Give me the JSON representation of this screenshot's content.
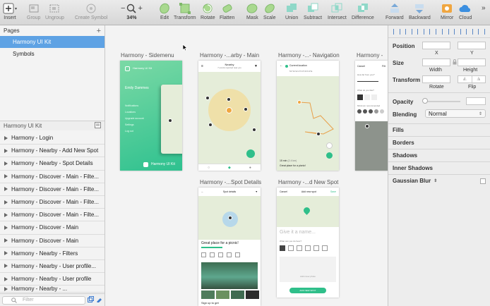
{
  "toolbar": {
    "items": [
      {
        "label": "Insert",
        "icon": "plus-icon"
      },
      {
        "label": "Group",
        "icon": "group-icon"
      },
      {
        "label": "Ungroup",
        "icon": "ungroup-icon"
      },
      {
        "label": "Create Symbol",
        "icon": "symbol-icon"
      },
      {
        "label": "34%",
        "icon": "zoom-icon"
      },
      {
        "label": "Edit",
        "icon": "edit-icon"
      },
      {
        "label": "Transform",
        "icon": "transform-icon"
      },
      {
        "label": "Rotate",
        "icon": "rotate-icon"
      },
      {
        "label": "Flatten",
        "icon": "flatten-icon"
      },
      {
        "label": "Mask",
        "icon": "mask-icon"
      },
      {
        "label": "Scale",
        "icon": "scale-icon"
      },
      {
        "label": "Union",
        "icon": "union-icon"
      },
      {
        "label": "Subtract",
        "icon": "subtract-icon"
      },
      {
        "label": "Intersect",
        "icon": "intersect-icon"
      },
      {
        "label": "Difference",
        "icon": "difference-icon"
      },
      {
        "label": "Forward",
        "icon": "forward-icon"
      },
      {
        "label": "Backward",
        "icon": "backward-icon"
      },
      {
        "label": "Mirror",
        "icon": "mirror-icon"
      },
      {
        "label": "Cloud",
        "icon": "cloud-icon"
      }
    ],
    "zoom_minus": "−",
    "zoom_plus": "+",
    "more": "»"
  },
  "pages": {
    "header": "Pages",
    "add": "+",
    "items": [
      "Harmony UI Kit",
      "Symbols"
    ]
  },
  "layers": {
    "header": "Harmony UI Kit",
    "items": [
      "Harmony - Login",
      "Harmony - Nearby - Add New Spot",
      "Harmony - Nearby - Spot Details",
      "Harmony - Discover - Main - Filte...",
      "Harmony - Discover - Main - Filte...",
      "Harmony - Discover - Main - Filte...",
      "Harmony - Discover - Main - Filte...",
      "Harmony - Discover - Main",
      "Harmony - Discover - Main",
      "Harmony - Nearby - Filters",
      "Harmony - Nearby - User profile...",
      "Harmony - Nearby - User profile",
      "Harmony - Nearby - ..."
    ],
    "filter_placeholder": "Filter"
  },
  "artboards": {
    "titles": [
      "Harmony - Sidemenu",
      "Harmony -...arby - Main",
      "Harmony -...- Navigation",
      "Harmony -",
      "Harmony -...Spot Details",
      "Harmony -...d New Spot"
    ],
    "sidemenu": {
      "brand": "Harmony UI Kit",
      "user": "Emily Dammes",
      "items": [
        "Notifications",
        "Locations",
        "Upgrade account",
        "Settings",
        "Log out"
      ],
      "footer": "Harmony UI Kit"
    },
    "main": {
      "title": "Nearby",
      "subtitle": "7 events reported near you"
    },
    "navigation": {
      "title": "Current location",
      "coords": "51°34'12.2\"N 0°21'9.3\"E",
      "eta": "15 min",
      "eta_sub": "(2.4 km)",
      "dest": "Great place for a picnic!"
    },
    "filters": {
      "cancel": "Cancel",
      "done": "Filt",
      "q1": "How far from you?",
      "q2": "What do you like?",
      "q3": "Minimum recommended"
    },
    "spot": {
      "title": "Spot details",
      "name": "Great place for a picnic!",
      "caption": "Sign up to get"
    },
    "newspot": {
      "cancel": "Cancel",
      "title": "Add new spot",
      "save": "Save",
      "placeholder": "Give it a name...",
      "question": "What can you do here?",
      "photo": "Add cover photo",
      "button": "ADD NEW SPOT"
    }
  },
  "inspector": {
    "position": "Position",
    "x": "X",
    "y": "Y",
    "size": "Size",
    "width": "Width",
    "height": "Height",
    "transform": "Transform",
    "rotate": "Rotate",
    "flip": "Flip",
    "opacity": "Opacity",
    "blending": "Blending",
    "blending_value": "Normal",
    "sections": [
      "Fills",
      "Borders",
      "Shadows",
      "Inner Shadows",
      "Gaussian Blur"
    ]
  },
  "colors": {
    "accent": "#5ea2e4",
    "brand_green": "#2fbf8a",
    "map_bg": "#e5edd9",
    "route": "#e8a04a"
  }
}
